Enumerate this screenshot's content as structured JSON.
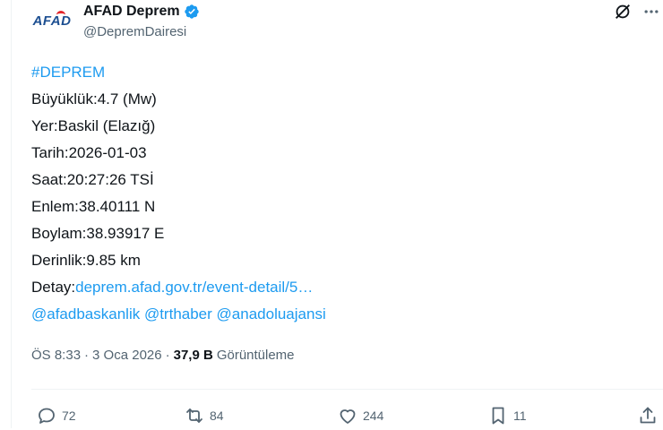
{
  "author": {
    "logo_text": "AFAD",
    "display_name": "AFAD Deprem",
    "handle": "@DepremDairesi",
    "verified_color": "#1d9bf0"
  },
  "tweet": {
    "hashtag": "#DEPREM",
    "lines": [
      "Büyüklük:4.7 (Mw)",
      "Yer:Baskil (Elazığ)",
      "Tarih:2026-01-03",
      "Saat:20:27:26 TSİ",
      "Enlem:38.40111 N",
      "Boylam:38.93917 E",
      "Derinlik:9.85 km"
    ],
    "detail_label": "Detay:",
    "detail_link": "deprem.afad.gov.tr/event-detail/5…",
    "mentions": [
      "@afadbaskanlik",
      "@trthaber",
      "@anadoluajansi"
    ]
  },
  "meta": {
    "time": "ÖS 8:33",
    "separator": "·",
    "date": "3 Oca 2026",
    "views_count": "37,9 B",
    "views_label": "Görüntüleme"
  },
  "actions": {
    "reply_count": "72",
    "repost_count": "84",
    "like_count": "244",
    "bookmark_count": "11"
  },
  "colors": {
    "link": "#1d9bf0",
    "text": "#0f1419",
    "muted": "#536471",
    "logo_blue": "#1d4f91",
    "logo_red": "#e3262c"
  }
}
